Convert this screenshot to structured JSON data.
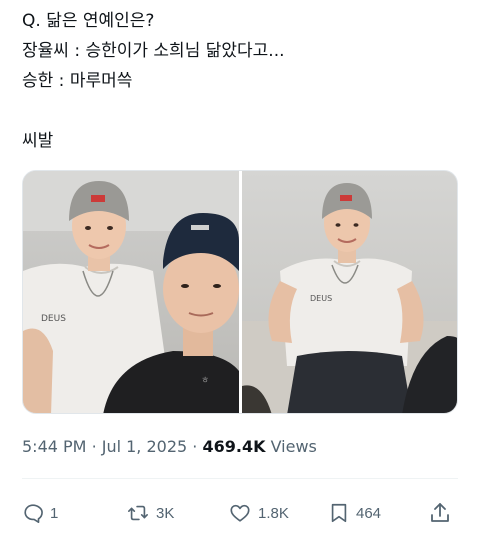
{
  "tweet": {
    "lines": [
      "Q. 닮은 연예인은?",
      "장율씨 : 승한이가 소희님 닮았다고...",
      "승한 : 마루머쓱",
      "씨발"
    ]
  },
  "meta": {
    "time": "5:44 PM",
    "date": "Jul 1, 2025",
    "views_count": "469.4K",
    "views_label": "Views"
  },
  "actions": {
    "reply_count": "1",
    "retweet_count": "3K",
    "like_count": "1.8K",
    "bookmark_count": "464"
  },
  "icons": {
    "reply": "reply-icon",
    "retweet": "retweet-icon",
    "like": "heart-icon",
    "bookmark": "bookmark-icon",
    "share": "share-icon"
  },
  "colors": {
    "text": "#0f1419",
    "secondary": "#536471",
    "border": "#eff3f4"
  }
}
